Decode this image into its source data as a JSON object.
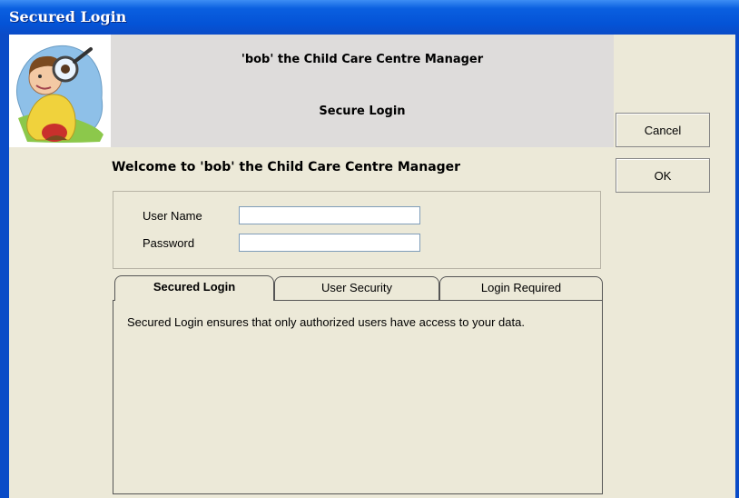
{
  "window": {
    "title": "Secured Login"
  },
  "header": {
    "app_name": "'bob' the Child Care Centre Manager",
    "subtitle": "Secure Login",
    "logo_icon": "detective-magnifying-glass-icon"
  },
  "welcome": "Welcome to 'bob' the Child Care Centre Manager",
  "form": {
    "username_label": "User Name",
    "username_value": "",
    "password_label": "Password",
    "password_value": ""
  },
  "buttons": {
    "cancel": "Cancel",
    "ok": "OK"
  },
  "tabs": [
    {
      "label": "Secured Login",
      "active": true
    },
    {
      "label": "User Security",
      "active": false
    },
    {
      "label": "Login Required",
      "active": false
    }
  ],
  "tab_content": "Secured Login ensures that only authorized users have access to your data.",
  "colors": {
    "titlebar": "#0453d6",
    "header_band": "#dedcdb",
    "dialog_bg": "#ece9d8"
  }
}
